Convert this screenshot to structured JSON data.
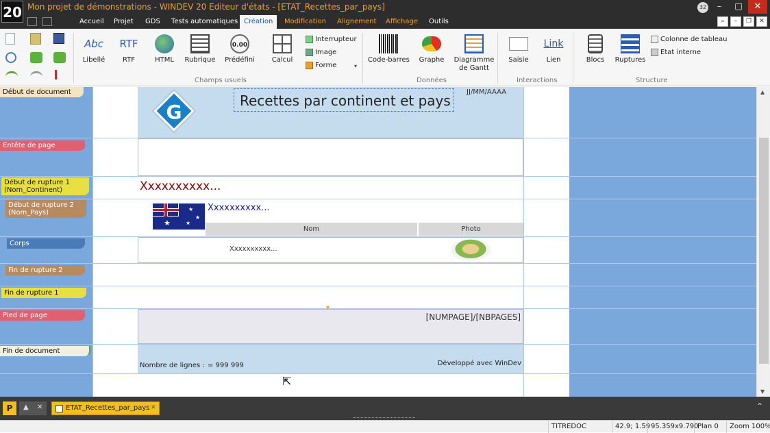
{
  "window": {
    "title": "Mon projet de démonstrations - WINDEV 20  Editeur d'états - [ETAT_Recettes_par_pays]",
    "logo": "20",
    "notification_count": "32",
    "controls": [
      "–",
      "▢",
      "✕"
    ]
  },
  "menu": [
    {
      "label": "Accueil",
      "style": "normal"
    },
    {
      "label": "Projet",
      "style": "normal"
    },
    {
      "label": "GDS",
      "style": "normal"
    },
    {
      "label": "Tests automatiques",
      "style": "normal"
    },
    {
      "label": "Création",
      "style": "active"
    },
    {
      "label": "Modification",
      "style": "orange"
    },
    {
      "label": "Alignement",
      "style": "orange"
    },
    {
      "label": "Affichage",
      "style": "orange"
    },
    {
      "label": "Outils",
      "style": "normal"
    }
  ],
  "ribbon": {
    "champs_usuels": {
      "label": "Champs usuels",
      "buttons": [
        "Libellé",
        "RTF",
        "HTML",
        "Rubrique",
        "Prédéfini",
        "Calcul"
      ],
      "libelle_icon_text": "Abc",
      "rtf_icon_text": "RTF",
      "predefini_icon_text": "0.00",
      "small": [
        "Interrupteur",
        "Image",
        "Forme"
      ]
    },
    "donnees": {
      "label": "Données",
      "buttons": [
        "Code-barres",
        "Graphe",
        "Diagramme",
        "de Gantt"
      ]
    },
    "interactions": {
      "label": "Interactions",
      "buttons": [
        "Saisie",
        "Lien"
      ],
      "lien_icon_text": "Link"
    },
    "structure": {
      "label": "Structure",
      "buttons": [
        "Blocs",
        "Ruptures"
      ],
      "small": [
        "Colonne de tableau",
        "Etat interne"
      ]
    }
  },
  "bands": {
    "debut_document": "Début de document",
    "entete_page": "Entête de page",
    "debut_rupture1": "Début de rupture 1",
    "debut_rupture1_sub": "(Nom_Continent)",
    "debut_rupture2": "Début de rupture 2",
    "debut_rupture2_sub": "(Nom_Pays)",
    "corps": "Corps",
    "fin_rupture2": "Fin de rupture 2",
    "fin_rupture1": "Fin de rupture 1",
    "pied_page": "Pied de page",
    "fin_document": "Fin de document"
  },
  "report": {
    "title": "Recettes par continent et pays",
    "date_field": "JJ/MM/AAAA",
    "continent_field": "Xxxxxxxxxx...",
    "country_field": "Xxxxxxxxxx...",
    "col_nom": "Nom",
    "col_photo": "Photo",
    "body_field": "Xxxxxxxxxx...",
    "page_field": "[NUMPAGE]/[NBPAGES]",
    "lines_label": "Nombre de lignes :",
    "lines_value": "= 999 999",
    "footer_note": "Développé avec WinDev"
  },
  "tabs": {
    "active": "ETAT_Recettes_par_pays"
  },
  "status": {
    "element": "TITREDOC",
    "position": "42.9; 1.59",
    "size": "95.359x9.790",
    "plan": "Plan 0",
    "zoom": "Zoom 100%"
  },
  "colors": {
    "blue_strip": "#7aa7dc",
    "band_light": "#c5dcef",
    "title_text": "#f0a030",
    "continent_text": "#8b0000",
    "country_text": "#1a1aa0"
  }
}
